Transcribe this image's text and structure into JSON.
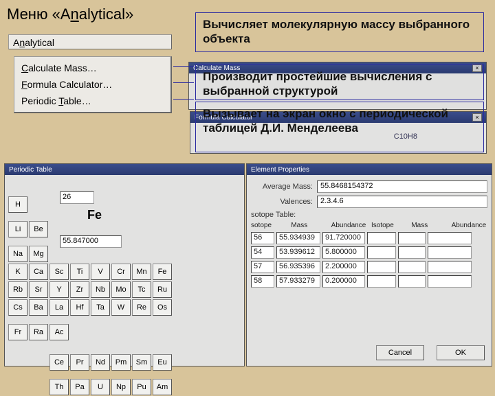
{
  "title_prefix": "Меню «A",
  "title_suffix": "alytical»",
  "menu_button": {
    "pre": "A",
    "u": "n",
    "post": "alytical"
  },
  "menu": {
    "items": [
      {
        "pre": "",
        "u": "C",
        "post": "alculate Mass…"
      },
      {
        "pre": "",
        "u": "F",
        "post": "ormula Calculator…"
      },
      {
        "pre": "Periodic ",
        "u": "T",
        "post": "able…"
      }
    ]
  },
  "explanations": {
    "e1": "Вычисляет молекулярную массу выбранного объекта",
    "e2": "Производит простейшие вычисления с выбранной структурой",
    "e3": "Вызывает на экран окно с периодической таблицей Д.И. Менделеева"
  },
  "calc_mass": {
    "title": "Calculate Mass"
  },
  "formula_calc": {
    "title": "Formula Calculator",
    "formula": "C10H8"
  },
  "periodic": {
    "title": "Periodic Table",
    "number": "26",
    "symbol": "Fe",
    "mass": "55.847000",
    "rows": [
      [
        "H",
        "",
        "",
        "",
        "",
        "",
        "",
        ""
      ],
      [
        "Li",
        "Be",
        "",
        "",
        "",
        "",
        "",
        ""
      ],
      [
        "Na",
        "Mg",
        "",
        "",
        "",
        "",
        "",
        ""
      ],
      [
        "K",
        "Ca",
        "Sc",
        "Ti",
        "V",
        "Cr",
        "Mn",
        "Fe"
      ],
      [
        "Rb",
        "Sr",
        "Y",
        "Zr",
        "Nb",
        "Mo",
        "Tc",
        "Ru"
      ],
      [
        "Cs",
        "Ba",
        "La",
        "Hf",
        "Ta",
        "W",
        "Re",
        "Os"
      ],
      [
        "Fr",
        "Ra",
        "Ac",
        "",
        "",
        "",
        "",
        ""
      ]
    ],
    "lanth": [
      "Ce",
      "Pr",
      "Nd",
      "Pm",
      "Sm",
      "Eu"
    ],
    "act": [
      "Th",
      "Pa",
      "U",
      "Np",
      "Pu",
      "Am"
    ]
  },
  "element_props": {
    "title": "Element Properties",
    "avg_mass_label": "Average Mass:",
    "avg_mass": "55.8468154372",
    "valences_label": "Valences:",
    "valences": "2.3.4.6",
    "iso_label": "sotope Table:",
    "head": [
      "sotope",
      "Mass",
      "Abundance",
      "Isotope",
      "Mass",
      "Abundance"
    ],
    "rows": [
      [
        "56",
        "55.934939",
        "91.720000",
        "",
        "",
        ""
      ],
      [
        "54",
        "53.939612",
        "5.800000",
        "",
        "",
        ""
      ],
      [
        "57",
        "56.935396",
        "2.200000",
        "",
        "",
        ""
      ],
      [
        "58",
        "57.933279",
        "0.200000",
        "",
        "",
        ""
      ]
    ],
    "cancel": "Cancel",
    "ok": "OK"
  }
}
